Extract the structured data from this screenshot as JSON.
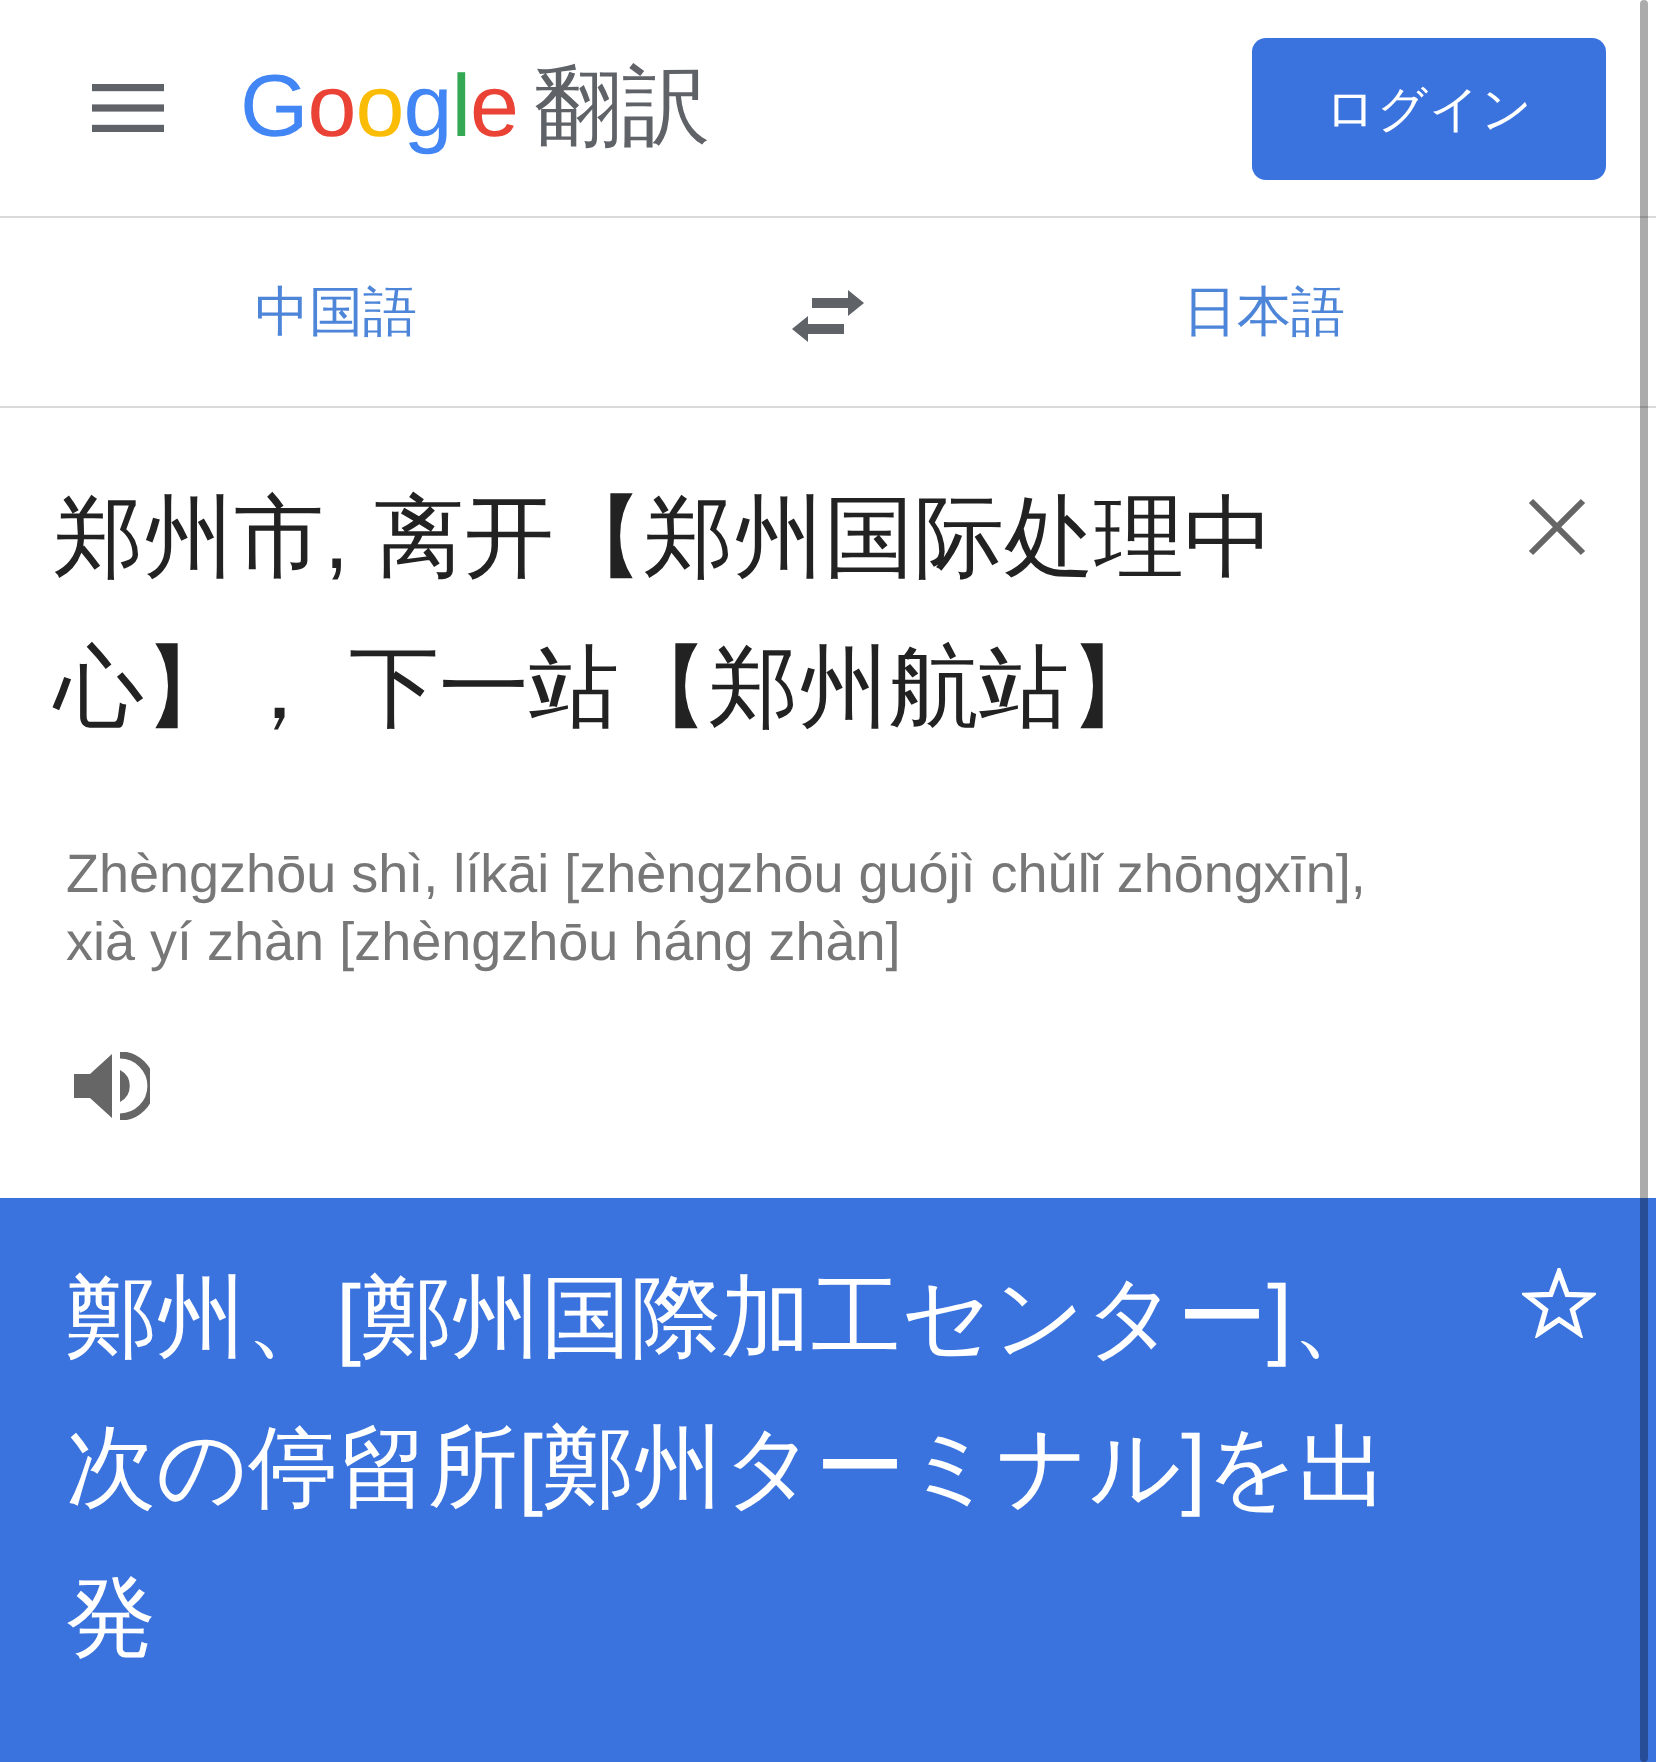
{
  "header": {
    "logo": {
      "brand": "Google",
      "product": "翻訳"
    },
    "login_button": "ログイン"
  },
  "language_bar": {
    "source_language": "中国語",
    "target_language": "日本語"
  },
  "source": {
    "text": "郑州市, 离开【郑州国际处理中心】， 下一站【郑州航站】",
    "romanization": "Zhèngzhōu shì, líkāi [zhèngzhōu guójì chǔlǐ zhōngxīn], xià yí zhàn [zhèngzhōu háng zhàn]"
  },
  "translation": {
    "text": "鄭州、[鄭州国際加工センター]、次の停留所[鄭州ターミナル]を出発",
    "starred": false
  }
}
